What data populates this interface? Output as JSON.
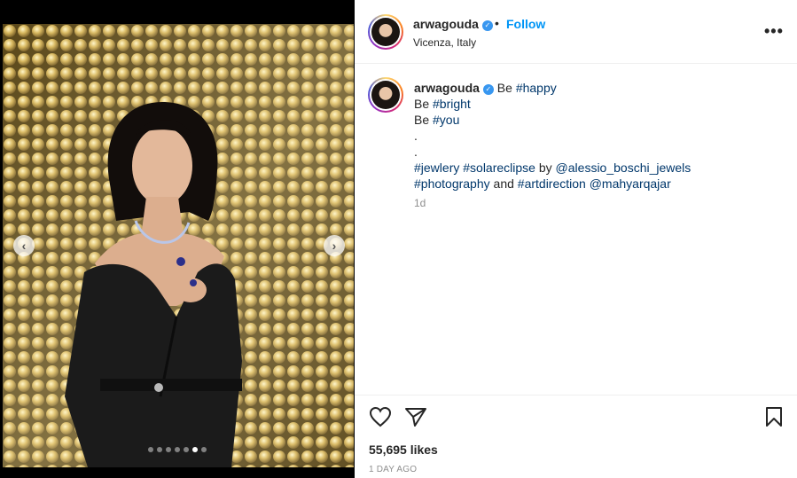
{
  "header": {
    "username": "arwagouda",
    "separator": "•",
    "follow_label": "Follow",
    "location": "Vicenza, Italy",
    "more_label": "•••"
  },
  "caption": {
    "username": "arwagouda",
    "line1_text": "Be ",
    "line1_tag": "#happy",
    "line2_text": "Be ",
    "line2_tag": "#bright",
    "line3_text": "Be ",
    "line3_tag": "#you",
    "line4": ".",
    "line5": ".",
    "line6_tag1": "#jewlery",
    "line6_tag2": "#solareclipse",
    "line6_by": " by ",
    "line6_mention": "@alessio_boschi_jewels",
    "line7_tag1": "#photography",
    "line7_and": " and ",
    "line7_tag2": "#artdirection",
    "line7_mention": "@mahyarqajar",
    "time_ago": "1d"
  },
  "carousel": {
    "prev_glyph": "‹",
    "next_glyph": "›",
    "total_slides": 7,
    "active_slide": 6
  },
  "stats": {
    "likes": "55,695 likes",
    "posted": "1 DAY AGO"
  },
  "icons": {
    "like": "heart-icon",
    "share": "paper-plane-icon",
    "save": "bookmark-icon",
    "verified": "verified-badge-icon",
    "more": "more-options-icon"
  },
  "colors": {
    "link": "#0095f6",
    "hashtag": "#00376b",
    "verified": "#3897f0",
    "muted": "#8e8e8e",
    "sequins": "#c9a84a"
  }
}
